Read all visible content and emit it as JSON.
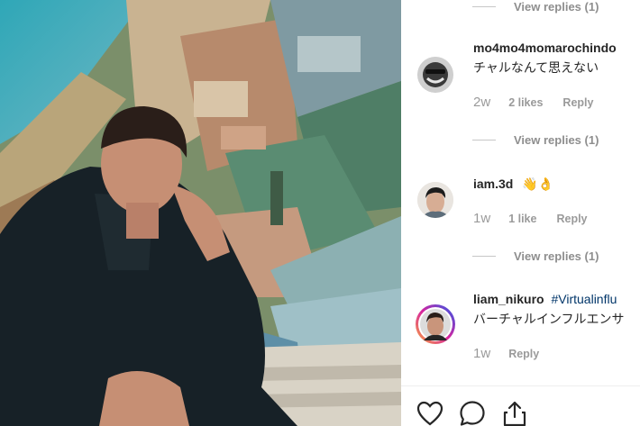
{
  "comments": [
    {
      "username": "mo4mo4momarochindo",
      "text": "チャルなんて思えない",
      "time": "2w",
      "likes": "2 likes",
      "reply": "Reply"
    },
    {
      "username": "iam.3d",
      "text": "👋👌",
      "time": "1w",
      "likes": "1 like",
      "reply": "Reply"
    },
    {
      "username": "liam_nikuro",
      "hashtag": "#Virtualinflu",
      "text": "バーチャルインフルエンサ",
      "time": "1w",
      "reply": "Reply"
    }
  ],
  "view_replies": [
    "View replies (1)",
    "View replies (1)",
    "View replies (1)"
  ],
  "icons": [
    "heart-icon",
    "comment-icon",
    "share-icon"
  ],
  "colors": {
    "link": "#003569",
    "muted": "#8e8e8e",
    "text": "#262626",
    "story_ring": "#d6249f"
  }
}
